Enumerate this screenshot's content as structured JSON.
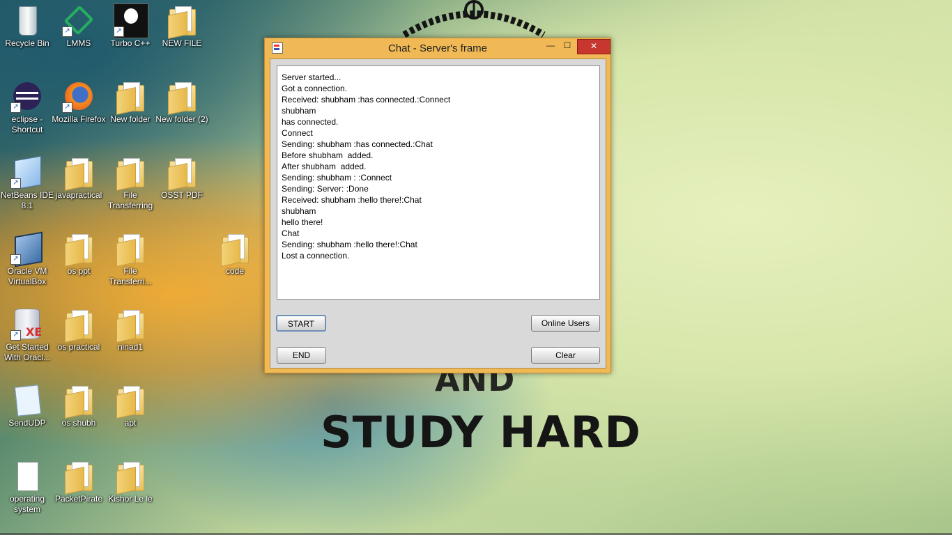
{
  "background": {
    "text_and": "AND",
    "text_study": "STUDY HARD"
  },
  "desktop_icons": [
    {
      "label": "Recycle Bin",
      "icon": "recycle-bin-icon"
    },
    {
      "label": "LMMS",
      "icon": "lmms-icon"
    },
    {
      "label": "Turbo C++",
      "icon": "turbo-cpp-icon"
    },
    {
      "label": "NEW FILE",
      "icon": "folder-icon"
    },
    {
      "label": "eclipse - Shortcut",
      "icon": "eclipse-icon"
    },
    {
      "label": "Mozilla Firefox",
      "icon": "firefox-icon"
    },
    {
      "label": "New folder",
      "icon": "folder-icon"
    },
    {
      "label": "New folder (2)",
      "icon": "folder-icon"
    },
    {
      "label": "NetBeans IDE 8.1",
      "icon": "netbeans-icon"
    },
    {
      "label": "javapractical",
      "icon": "folder-icon"
    },
    {
      "label": "File Transferring",
      "icon": "folder-icon"
    },
    {
      "label": "OSST PDF",
      "icon": "folder-icon"
    },
    {
      "label": "Oracle VM VirtualBox",
      "icon": "virtualbox-icon"
    },
    {
      "label": "os ppt",
      "icon": "folder-icon"
    },
    {
      "label": "File Transferri...",
      "icon": "folder-icon"
    },
    {
      "label": "code",
      "icon": "folder-icon"
    },
    {
      "label": "Get Started With Oracl...",
      "icon": "oracle-xe-icon"
    },
    {
      "label": "os practical",
      "icon": "folder-icon"
    },
    {
      "label": "ninad1",
      "icon": "folder-icon"
    },
    {
      "label": "SendUDP",
      "icon": "notepad-icon"
    },
    {
      "label": "os shubh",
      "icon": "folder-icon"
    },
    {
      "label": "apt",
      "icon": "folder-icon"
    },
    {
      "label": "operating system",
      "icon": "text-file-icon"
    },
    {
      "label": "PacketPirate",
      "icon": "folder-icon"
    },
    {
      "label": "Kishor Le le",
      "icon": "folder-icon"
    }
  ],
  "window": {
    "title": "Chat - Server's frame",
    "min_glyph": "—",
    "max_glyph": "☐",
    "close_glyph": "✕",
    "log_lines": [
      "Server started...",
      "Got a connection.",
      "Received: shubham :has connected.:Connect",
      "shubham",
      "has connected.",
      "Connect",
      "Sending: shubham :has connected.:Chat",
      "Before shubham  added.",
      "After shubham  added.",
      "Sending: shubham : :Connect",
      "Sending: Server: :Done",
      "Received: shubham :hello there!:Chat",
      "shubham",
      "hello there!",
      "Chat",
      "Sending: shubham :hello there!:Chat",
      "Lost a connection."
    ],
    "buttons": {
      "start": "START",
      "online_users": "Online Users",
      "end": "END",
      "clear": "Clear"
    }
  }
}
